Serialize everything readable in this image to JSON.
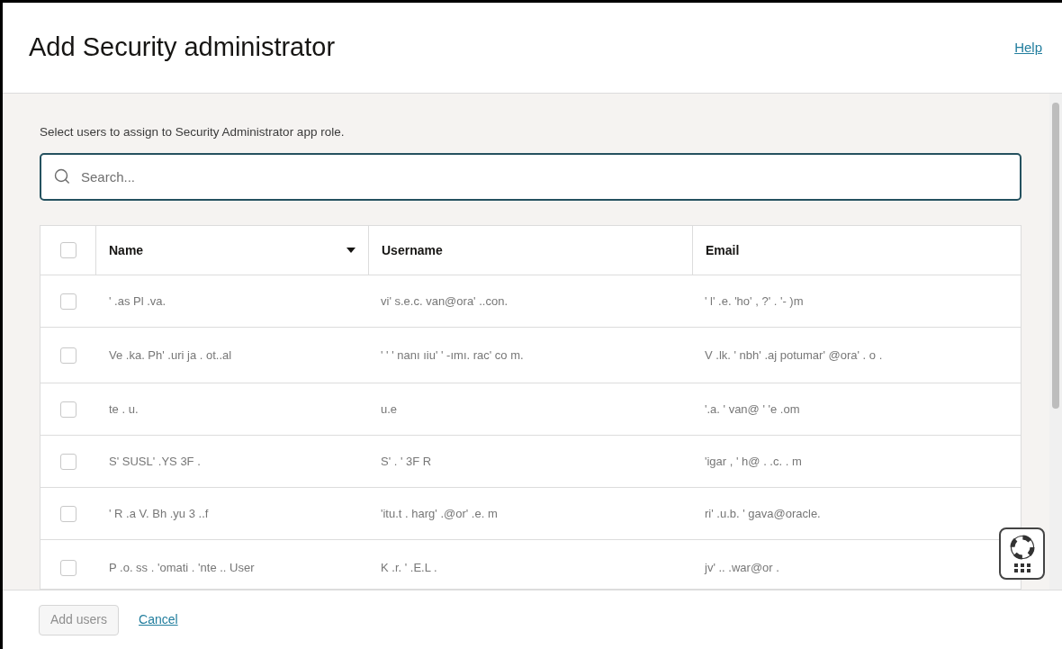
{
  "dialog": {
    "title": "Add Security administrator",
    "help_link": "Help"
  },
  "instructions": "Select users to assign to Security Administrator app role.",
  "search": {
    "placeholder": "Search..."
  },
  "table": {
    "select_all": {
      "checked": false
    },
    "columns": [
      {
        "label": "Name",
        "sorted": true
      },
      {
        "label": "Username",
        "sorted": false
      },
      {
        "label": "Email",
        "sorted": false
      }
    ],
    "rows": [
      {
        "checked": false,
        "cells": [
          "' .as Pl .va.",
          "vi' s.e.c. van@ora' ..con.",
          "' l' .e. 'ho' , ?' . '- )m"
        ]
      },
      {
        "checked": false,
        "cells": [
          "Ve .ka. Ph' .uri ja . ot..al",
          "' ' ' nanı ıiu' ' -ımı. rac' co m.",
          "V .lk. ' nbh' .aj potumar' @ora' . o ."
        ]
      },
      {
        "checked": false,
        "cells": [
          "te . u.",
          "u.e",
          "'.a. ' van@ ' 'e .om"
        ]
      },
      {
        "checked": false,
        "cells": [
          "S' SUSL' .YS 3F .",
          "S' . ' 3F R",
          "'igar , ' h@ . .c. . m"
        ]
      },
      {
        "checked": false,
        "cells": [
          "' R .a V. Bh .yu 3 ..f",
          "'itu.t . harg' .@or' .e. m",
          "ri' .u.b. ' gava@oracle."
        ]
      },
      {
        "checked": false,
        "cells": [
          "P .o. ss . 'omati . 'nte .. User",
          "K .r. ' .E.L .",
          "jv' .. .war@or ."
        ]
      }
    ]
  },
  "footer": {
    "buttons": [
      {
        "label": "Add users",
        "disabled": true,
        "kind": "button"
      },
      {
        "label": "Cancel",
        "disabled": false,
        "kind": "link"
      }
    ]
  }
}
